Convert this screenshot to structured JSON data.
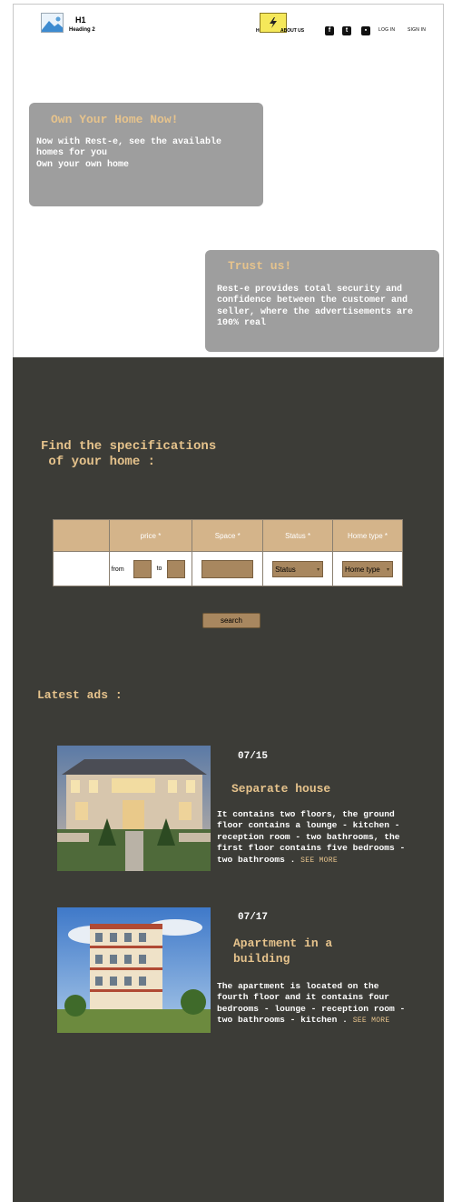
{
  "header": {
    "logo_icon": "image-placeholder-icon",
    "title": "H1",
    "subtitle": "Heading 2",
    "nav": {
      "home": "HOME",
      "about": "ABOUT US",
      "flash_icon": "lightning-icon"
    },
    "social_icons": [
      "facebook-icon",
      "twitter-icon",
      "contact-card-icon"
    ],
    "login": "LOG IN",
    "signin": "SIGN IN"
  },
  "hero": {
    "title": "Own Your Home Now!",
    "line1": "Now with Rest-e, see the available",
    "line2": "homes for you",
    "line3": "Own your own home"
  },
  "trust": {
    "title": "Trust us!",
    "line1": "Rest-e provides total security and",
    "line2": "confidence between the customer and",
    "line3": "seller, where the advertisements are",
    "line4": "100% real"
  },
  "search": {
    "title_line1": "Find the specifications",
    "title_line2": " of your home :",
    "columns": [
      "",
      "price *",
      "Space *",
      "Status *",
      "Home type *"
    ],
    "from_label": "from",
    "to_label": "to",
    "status_value": "Status",
    "home_type_value": "Home type",
    "button": "search"
  },
  "latest": {
    "heading": "Latest ads :",
    "ads": [
      {
        "date": "07/15",
        "title_line1": "Separate house",
        "title_line2": "",
        "lines": [
          "It contains two floors, the ground",
          "floor contains a lounge - kitchen -",
          "reception room - two bathrooms, the",
          "first floor contains five bedrooms -",
          "two bathrooms ."
        ],
        "see_more": "SEE MORE"
      },
      {
        "date": "07/17",
        "title_line1": "Apartment in a",
        "title_line2": "building",
        "lines": [
          "The apartment is located on the",
          "fourth floor and it contains four",
          "bedrooms - lounge - reception room -",
          "two bathrooms - kitchen ."
        ],
        "see_more": "SEE MORE"
      }
    ]
  },
  "colors": {
    "accent": "#e6c38c",
    "dark_bg": "#3c3c37",
    "card_bg": "#9e9e9e",
    "table_header": "#d4b48a",
    "control": "#a8875f"
  }
}
